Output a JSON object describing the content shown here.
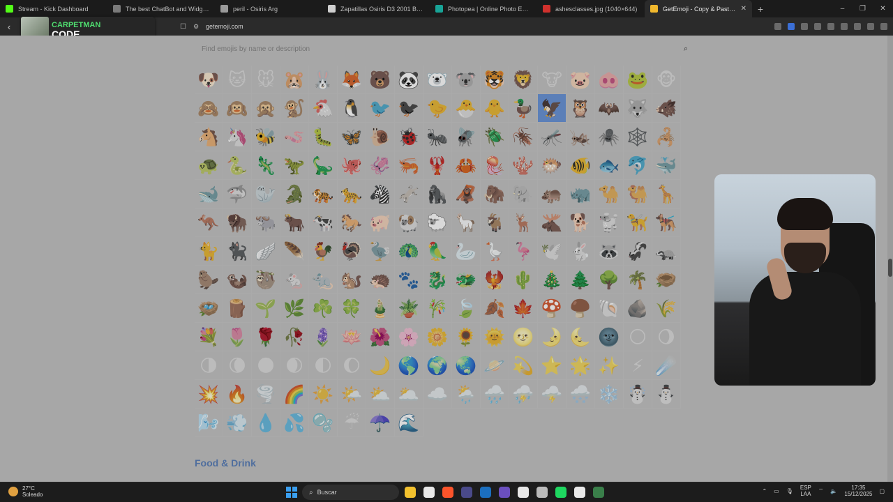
{
  "browser": {
    "tabs": [
      {
        "title": "Stream - Kick Dashboard",
        "color": "#53fc18",
        "active": false
      },
      {
        "title": "The best ChatBot and Widgets for Kick",
        "color": "#7a7a7a",
        "active": false
      },
      {
        "title": "peril - Osiris Arg",
        "color": "#9a9a9a",
        "active": false
      },
      {
        "title": "Zapatillas Osiris D3 2001 Black Black",
        "color": "#cfcfcf",
        "active": false
      },
      {
        "title": "Photopea | Online Photo Editor",
        "color": "#18a497",
        "active": false
      },
      {
        "title": "ashesclasses.jpg (1040×644)",
        "color": "#d0312d",
        "active": false
      },
      {
        "title": "GetEmoji - Copy & Paste All Emojis",
        "color": "#f1b82d",
        "active": true
      }
    ],
    "new_tab": "+",
    "window_controls": {
      "minimize": "–",
      "maximize": "❐",
      "close": "✕"
    },
    "url": "getemoji.com"
  },
  "overlay": {
    "channel": "CARPETMAN",
    "subtitle": "CODE"
  },
  "page": {
    "search": {
      "placeholder": "Find emojis by name or description"
    },
    "highlight_index": 29,
    "emojis": [
      "🐶",
      "🐱",
      "🐭",
      "🐹",
      "🐰",
      "🦊",
      "🐻",
      "🐼",
      "🐻‍❄️",
      "🐨",
      "🐯",
      "🦁",
      "🐮",
      "🐷",
      "🐽",
      "🐸",
      "🐵",
      "🙈",
      "🙉",
      "🙊",
      "🐒",
      "🐔",
      "🐧",
      "🐦",
      "🐦‍⬛",
      "🐤",
      "🐣",
      "🐥",
      "🦆",
      "🦅",
      "🦉",
      "🦇",
      "🐺",
      "🐗",
      "🐴",
      "🦄",
      "🐝",
      "🪱",
      "🐛",
      "🦋",
      "🐌",
      "🐞",
      "🐜",
      "🪰",
      "🪲",
      "🪳",
      "🦟",
      "🦗",
      "🕷️",
      "🕸️",
      "🦂",
      "🐢",
      "🐍",
      "🦎",
      "🦖",
      "🦕",
      "🐙",
      "🦑",
      "🦐",
      "🦞",
      "🦀",
      "🪼",
      "🪸",
      "🐡",
      "🐠",
      "🐟",
      "🐬",
      "🐳",
      "🐋",
      "🦈",
      "🦭",
      "🐊",
      "🐅",
      "🐆",
      "🦓",
      "🫏",
      "🦍",
      "🦧",
      "🦣",
      "🐘",
      "🦛",
      "🦏",
      "🐪",
      "🐫",
      "🦒",
      "🦘",
      "🦬",
      "🐃",
      "🐂",
      "🐄",
      "🐎",
      "🐖",
      "🐏",
      "🐑",
      "🦙",
      "🐐",
      "🦌",
      "🫎",
      "🐕",
      "🐩",
      "🦮",
      "🐕‍🦺",
      "🐈",
      "🐈‍⬛",
      "🪽",
      "🪶",
      "🐓",
      "🦃",
      "🦤",
      "🦚",
      "🦜",
      "🦢",
      "🪿",
      "🦩",
      "🕊️",
      "🐇",
      "🦝",
      "🦨",
      "🦡",
      "🦫",
      "🦦",
      "🦥",
      "🐁",
      "🐀",
      "🐿️",
      "🦔",
      "🐾",
      "🐉",
      "🐲",
      "🐦‍🔥",
      "🌵",
      "🎄",
      "🌲",
      "🌳",
      "🌴",
      "🪹",
      "🪺",
      "🪵",
      "🌱",
      "🌿",
      "☘️",
      "🍀",
      "🎍",
      "🪴",
      "🎋",
      "🍃",
      "🍂",
      "🍁",
      "🍄",
      "🍄‍🟫",
      "🐚",
      "🪨",
      "🌾",
      "💐",
      "🌷",
      "🌹",
      "🥀",
      "🪻",
      "🪷",
      "🌺",
      "🌸",
      "🌼",
      "🌻",
      "🌞",
      "🌝",
      "🌛",
      "🌜",
      "🌚",
      "🌕",
      "🌖",
      "🌗",
      "🌘",
      "🌑",
      "🌒",
      "🌓",
      "🌔",
      "🌙",
      "🌎",
      "🌍",
      "🌏",
      "🪐",
      "💫",
      "⭐",
      "🌟",
      "✨",
      "⚡",
      "☄️",
      "💥",
      "🔥",
      "🌪️",
      "🌈",
      "☀️",
      "🌤️",
      "⛅",
      "🌥️",
      "☁️",
      "🌦️",
      "🌧️",
      "⛈️",
      "🌩️",
      "🌨️",
      "❄️",
      "☃️",
      "⛄",
      "🌬️",
      "💨",
      "💧",
      "💦",
      "🫧",
      "☔",
      "☂️",
      "🌊"
    ],
    "next_section": "Food & Drink"
  },
  "taskbar": {
    "weather": {
      "temp": "27°C",
      "condition": "Soleado"
    },
    "search_label": "Buscar",
    "lang": {
      "line1": "ESP",
      "line2": "LAA"
    },
    "clock": {
      "time": "17:35",
      "date": "15/12/2025"
    },
    "apps": [
      "#f2c12e",
      "#e8e8e8",
      "#fb542b",
      "#4a4a8a",
      "#1b6fbf",
      "#6b4fbf",
      "#e7e7e7",
      "#bbbbbb",
      "#1ed760",
      "#e8e8e8",
      "#3a7f4a"
    ]
  }
}
